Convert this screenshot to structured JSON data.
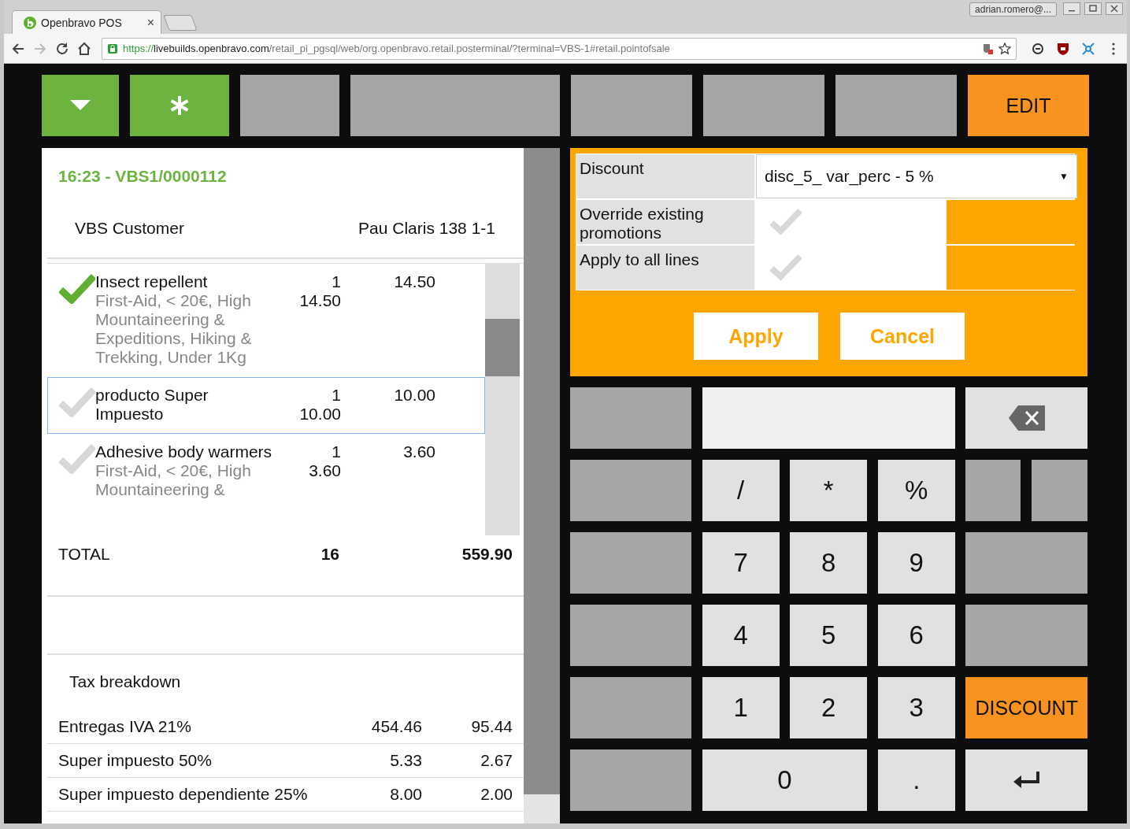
{
  "browser": {
    "tab_title": "Openbravo POS",
    "tab_close": "×",
    "user": "adrian.romero@...",
    "url_scheme": "https://",
    "url_host": "livebuilds.openbravo.com",
    "url_path": "/retail_pi_pgsql/web/org.openbravo.retail.posterminal/?terminal=VBS-1#retail.pointofsale"
  },
  "toolbar": [
    {
      "kind": "menu"
    },
    {
      "kind": "new"
    },
    {
      "kind": "blank"
    },
    {
      "kind": "blank_wide"
    },
    {
      "kind": "blank"
    },
    {
      "kind": "blank"
    },
    {
      "kind": "blank"
    },
    {
      "kind": "text",
      "label": "EDIT"
    }
  ],
  "ticket": {
    "title": "16:23 - VBS1/0000112",
    "customer": "VBS Customer",
    "address": "Pau Claris 138 1-1",
    "lines": [
      {
        "name": "Insect repellent",
        "qty": "1",
        "price": "14.50",
        "total": "14.50",
        "categories": "First-Aid, < 20€, High Mountaineering & Expeditions, Hiking & Trekking, Under 1Kg",
        "checked": true,
        "selected": false
      },
      {
        "name": "producto Super Impuesto",
        "qty": "1",
        "price": "10.00",
        "total": "10.00",
        "checked": false,
        "selected": true
      },
      {
        "name": "Adhesive body warmers",
        "qty": "1",
        "price": "3.60",
        "total": "3.60",
        "categories": "First-Aid, < 20€, High Mountaineering &",
        "checked": false,
        "selected": false
      }
    ],
    "total_label": "TOTAL",
    "total_qty": "16",
    "total_amount": "559.90",
    "tax_title": "Tax breakdown",
    "taxes": [
      {
        "name": "Entregas IVA 21%",
        "base": "454.46",
        "amount": "95.44"
      },
      {
        "name": "Super impuesto 50%",
        "base": "5.33",
        "amount": "2.67"
      },
      {
        "name": "Super impuesto dependiente 25%",
        "base": "8.00",
        "amount": "2.00"
      }
    ]
  },
  "discount_panel": {
    "discount_label": "Discount",
    "discount_value": "disc_5_ var_perc - 5 %",
    "dropdown_arrow": "▼",
    "options": [
      {
        "label": "Override existing promotions",
        "checked": false
      },
      {
        "label": "Apply to all lines",
        "checked": false
      }
    ],
    "apply": "Apply",
    "cancel": "Cancel"
  },
  "keypad": [
    [
      {
        "kind": "blank"
      },
      {
        "kind": "input"
      },
      {
        "kind": "backspace"
      }
    ],
    [
      {
        "kind": "blank"
      },
      {
        "kind": "key",
        "label": "/"
      },
      {
        "kind": "key",
        "label": "*"
      },
      {
        "kind": "key",
        "label": "%"
      },
      {
        "kind": "blank"
      },
      {
        "kind": "blank"
      }
    ],
    [
      {
        "kind": "blank"
      },
      {
        "kind": "key",
        "label": "7"
      },
      {
        "kind": "key",
        "label": "8"
      },
      {
        "kind": "key",
        "label": "9"
      },
      {
        "kind": "blank_wide"
      }
    ],
    [
      {
        "kind": "blank"
      },
      {
        "kind": "key",
        "label": "4"
      },
      {
        "kind": "key",
        "label": "5"
      },
      {
        "kind": "key",
        "label": "6"
      },
      {
        "kind": "blank_wide"
      }
    ],
    [
      {
        "kind": "blank"
      },
      {
        "kind": "key",
        "label": "1"
      },
      {
        "kind": "key",
        "label": "2"
      },
      {
        "kind": "key",
        "label": "3"
      },
      {
        "kind": "action",
        "label": "DISCOUNT"
      }
    ],
    [
      {
        "kind": "blank"
      },
      {
        "kind": "key_wide",
        "label": "0"
      },
      {
        "kind": "key",
        "label": "."
      },
      {
        "kind": "enter"
      }
    ]
  ]
}
